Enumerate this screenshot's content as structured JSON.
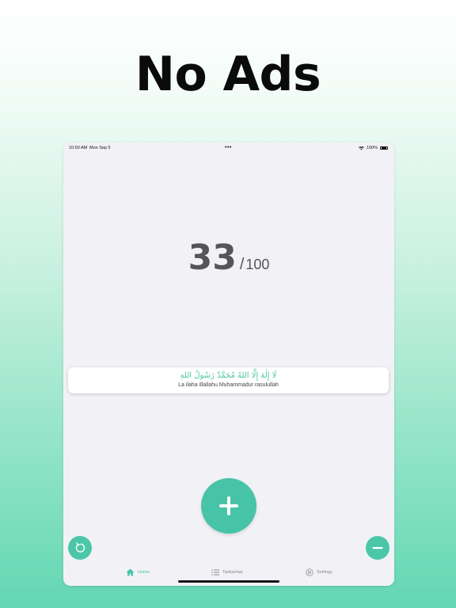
{
  "headline": "No Ads",
  "status_bar": {
    "time": "10:50 AM",
    "date": "Mon Sep 5",
    "dots": "•••",
    "battery": "100%"
  },
  "counter": {
    "count": "33",
    "separator": "/",
    "target": "100"
  },
  "dhikr": {
    "arabic": "لَا إِلٰهَ إِلَّا اللهُ مُحَمَّدٌ رَسُولُ اللهِ",
    "transliteration": "La ilaha illallahu Muhammadur rasulullah"
  },
  "tabs": [
    {
      "label": "Home",
      "icon": "home-icon",
      "active": true
    },
    {
      "label": "Tasbeehat",
      "icon": "list-icon",
      "active": false
    },
    {
      "label": "Settings",
      "icon": "settings-icon",
      "active": false
    }
  ],
  "colors": {
    "accent": "#47c4a8",
    "counter_text": "#555556",
    "inactive_tab": "#8a8a8e"
  }
}
